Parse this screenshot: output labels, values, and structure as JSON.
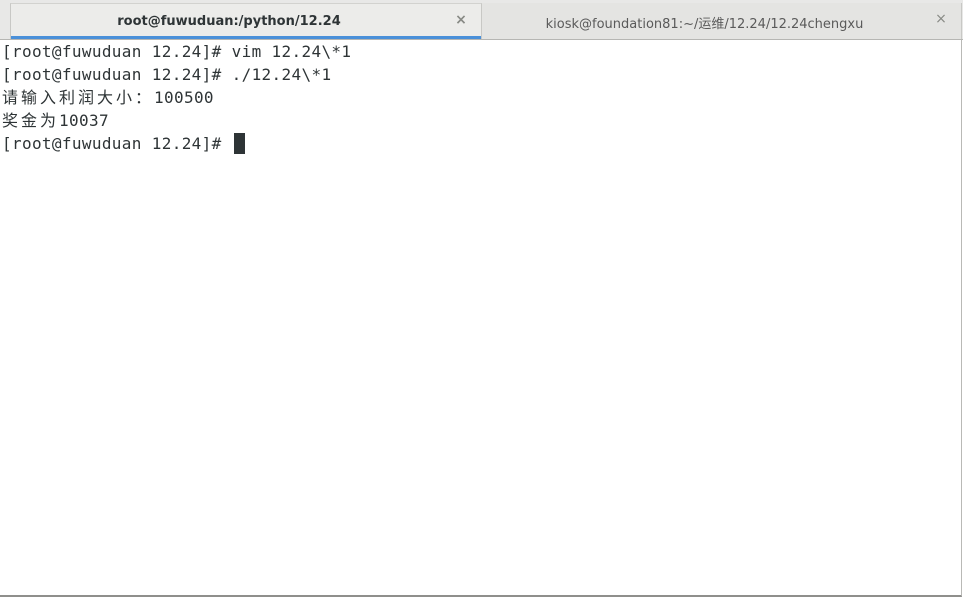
{
  "tabs": [
    {
      "label": "root@fuwuduan:/python/12.24",
      "close": "×",
      "active": true
    },
    {
      "label": "kiosk@foundation81:~/运维/12.24/12.24chengxu",
      "close": "×",
      "active": false
    }
  ],
  "terminal": {
    "lines": [
      "[root@fuwuduan 12.24]# vim 12.24\\*1",
      "[root@fuwuduan 12.24]# ./12.24\\*1"
    ],
    "prompt_input_label": "请输入利润大小：",
    "prompt_input_value": "100500",
    "bonus_label": "奖金为",
    "bonus_value": "10037",
    "current_prompt": "[root@fuwuduan 12.24]# "
  },
  "colors": {
    "accent": "#4a90d9",
    "text": "#2e3436",
    "tabbar": "#e8e8e7"
  }
}
